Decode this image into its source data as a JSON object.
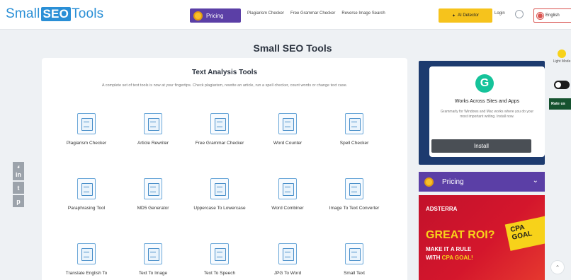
{
  "header": {
    "logo": {
      "part1": "Small",
      "part2": "SEO",
      "part3": "Tools"
    },
    "pricing_label": "Pricing",
    "nav_links": [
      "Plagiarism Checker",
      "Free Grammar Checker",
      "Reverse Image Search"
    ],
    "ai_detector_label": "AI Detector",
    "login_label": "Login",
    "language_label": "English"
  },
  "page": {
    "title": "Small SEO Tools"
  },
  "card": {
    "title": "Text Analysis Tools",
    "subtitle": "A complete set of text tools is now at your fingertips. Check plagiarism, rewrite an article, run a spell checker, count words or change text case.",
    "tools": [
      "Plagiarism Checker",
      "Article Rewriter",
      "Free Grammar Checker",
      "Word Counter",
      "Spell Checker",
      "Paraphrasing Tool",
      "MD5 Generator",
      "Uppercase To Lowercase",
      "Word Combiner",
      "Image To Text Converter",
      "Translate English To",
      "Text To Image",
      "Text To Speech",
      "JPG To Word",
      "Small Text"
    ]
  },
  "social": [
    "f",
    "in",
    "t",
    "p"
  ],
  "ad_grammarly": {
    "logo": "G",
    "title": "Works Across Sites and Apps",
    "desc": "Grammarly for Windows and Mac works where you do your most important writing. Install now.",
    "install_label": "Install"
  },
  "pricing_bar": {
    "label": "Pricing",
    "chevron": "⌄"
  },
  "ad_adsterra": {
    "brand": "ADSTERRA",
    "headline": "GREAT ROI?",
    "line1": "MAKE IT A RULE",
    "line2a": "WITH ",
    "line2b": "CPA GOAL!",
    "badge": "CPA GOAL"
  },
  "right_edge": {
    "light_mode_label": "Light Mode",
    "rate_label": "Rate us",
    "scroll_top": "⌃"
  }
}
